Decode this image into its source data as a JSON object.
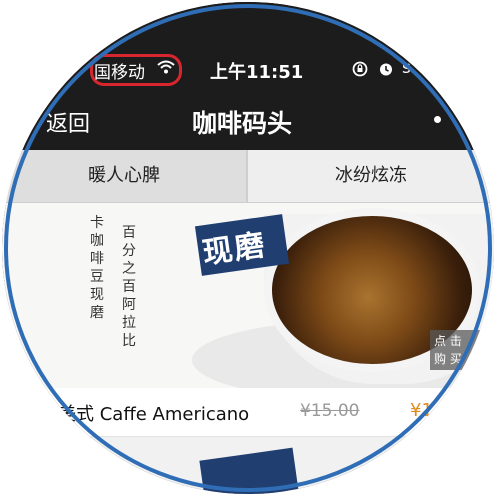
{
  "status_bar": {
    "carrier": "国移动",
    "time": "上午11:51",
    "battery_partial": "s"
  },
  "nav": {
    "back_label": "返回",
    "title": "咖啡码头"
  },
  "tabs": [
    {
      "label": "暖人心脾"
    },
    {
      "label": "冰纷炫冻"
    }
  ],
  "product": {
    "poem_line1": "卡咖啡豆现磨",
    "poem_line2": "百分之百阿拉比",
    "stamp": "现磨",
    "buy_overlay": "点 击 购 买",
    "name": "美式 Caffe Americano",
    "original_price": "¥15.00",
    "price": "¥1"
  },
  "colors": {
    "ring": "#2f6eb6",
    "carrier_highlight": "#d8262f",
    "price": "#e08a1e"
  }
}
